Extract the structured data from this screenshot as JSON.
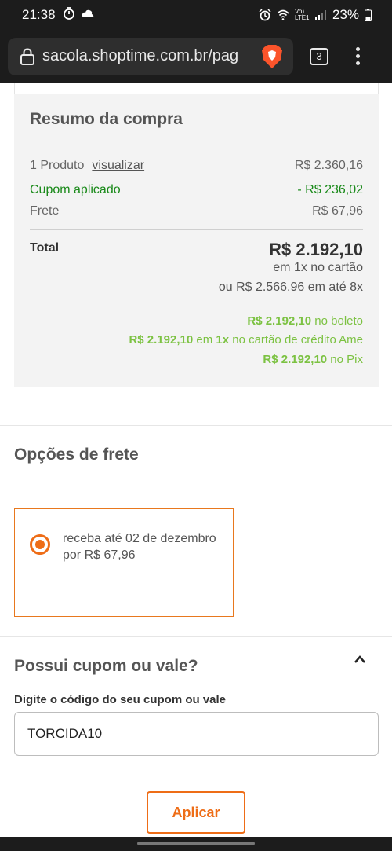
{
  "status_bar": {
    "time": "21:38",
    "battery": "23%",
    "network": "Vo) LTE1"
  },
  "browser": {
    "url": "sacola.shoptime.com.br/pag",
    "tab_count": "3"
  },
  "summary": {
    "title": "Resumo da compra",
    "product_label": "1 Produto",
    "product_link": "visualizar",
    "product_value": "R$ 2.360,16",
    "coupon_label": "Cupom aplicado",
    "coupon_value": "- R$ 236,02",
    "shipping_label": "Frete",
    "shipping_value": "R$ 67,96",
    "total_label": "Total",
    "total_value": "R$ 2.192,10",
    "total_sub1": "em 1x no cartão",
    "total_sub2": "ou R$ 2.566,96 em até 8x",
    "pay_boleto_value": "R$ 2.192,10",
    "pay_boleto_text": " no boleto",
    "pay_ame_value": "R$ 2.192,10",
    "pay_ame_mid": " em ",
    "pay_ame_installments": "1x",
    "pay_ame_text": " no cartão de crédito Ame",
    "pay_pix_value": "R$ 2.192,10",
    "pay_pix_text": " no Pix"
  },
  "shipping_options": {
    "title": "Opções de frete",
    "option_text": "receba até 02 de dezembro por R$ 67,96"
  },
  "coupon": {
    "title": "Possui cupom ou vale?",
    "field_label": "Digite o código do seu cupom ou vale",
    "field_value": "TORCIDA10",
    "apply_label": "Aplicar"
  },
  "colors": {
    "accent": "#ee6d17",
    "green_text": "#1a8a1a",
    "payment_green": "#7cc242"
  }
}
